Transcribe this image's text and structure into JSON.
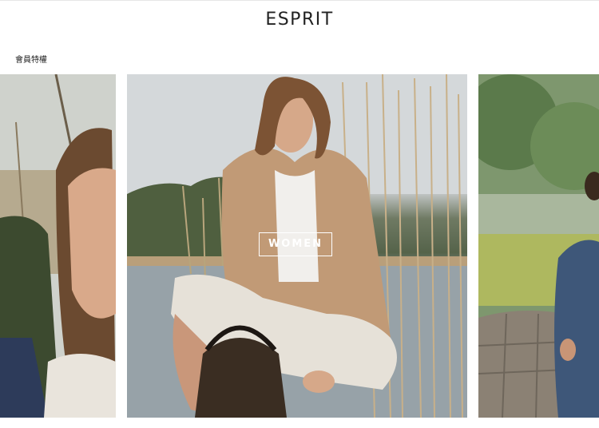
{
  "header": {
    "logo_text": "ESPRIT",
    "member_link": "會員特權"
  },
  "carousel": {
    "slides": [
      {
        "position": "left",
        "label": ""
      },
      {
        "position": "center",
        "label": "WOMEN"
      },
      {
        "position": "right",
        "label": ""
      }
    ]
  },
  "colors": {
    "background": "#ffffff",
    "text": "#222222",
    "label_border": "#ffffff"
  }
}
